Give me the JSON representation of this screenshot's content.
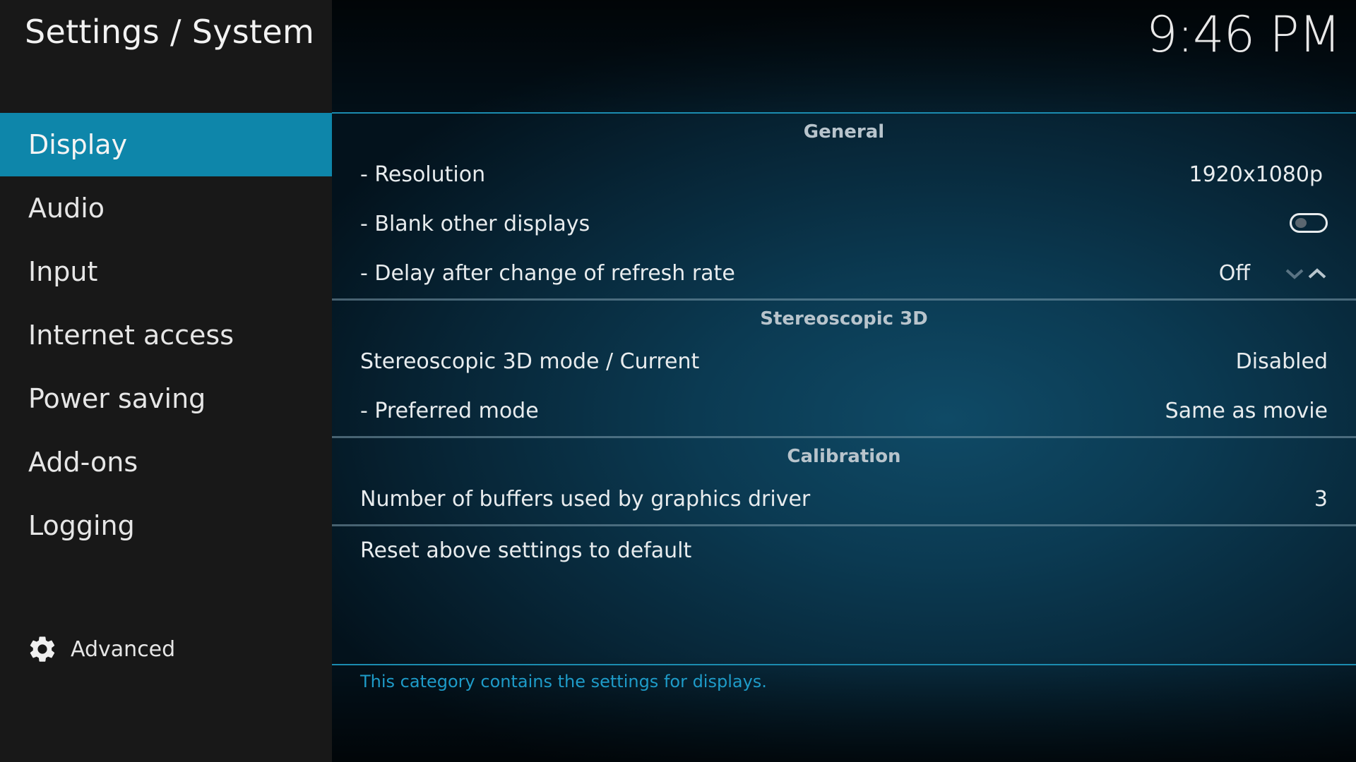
{
  "header": {
    "title": "Settings / System",
    "clock": "9:46 PM"
  },
  "sidebar": {
    "items": [
      {
        "label": "Display"
      },
      {
        "label": "Audio"
      },
      {
        "label": "Input"
      },
      {
        "label": "Internet access"
      },
      {
        "label": "Power saving"
      },
      {
        "label": "Add-ons"
      },
      {
        "label": "Logging"
      }
    ],
    "advanced_label": "Advanced",
    "advanced_icon": "gear-icon",
    "active_color": "#0e86aa"
  },
  "main": {
    "sections": {
      "general": {
        "title": "General",
        "resolution": {
          "label": "- Resolution",
          "value": "1920x1080p"
        },
        "blank_displays": {
          "label": "- Blank other displays",
          "enabled": false
        },
        "refresh_delay": {
          "label": "- Delay after change of refresh rate",
          "value": "Off"
        }
      },
      "stereo": {
        "title": "Stereoscopic 3D",
        "mode_current": {
          "label": "Stereoscopic 3D mode / Current",
          "value": "Disabled"
        },
        "preferred_mode": {
          "label": "- Preferred mode",
          "value": "Same as movie"
        }
      },
      "calibration": {
        "title": "Calibration",
        "buffers": {
          "label": "Number of buffers used by graphics driver",
          "value": "3"
        }
      }
    },
    "reset_label": "Reset above settings to default",
    "description": "This category contains the settings for displays."
  }
}
